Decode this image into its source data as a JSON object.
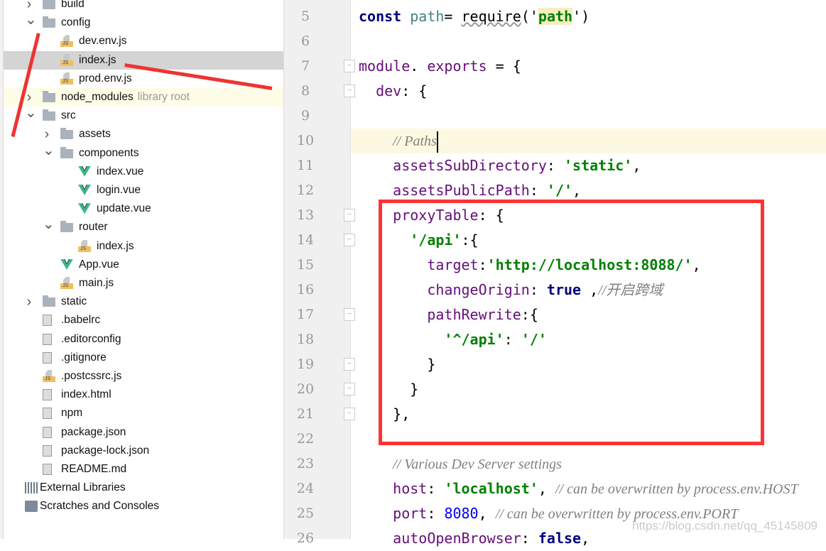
{
  "project_tree": [
    {
      "label": "build",
      "icon": "folder-icon",
      "depth": 0,
      "chevron": "right"
    },
    {
      "label": "config",
      "icon": "folder-icon",
      "depth": 0,
      "chevron": "down"
    },
    {
      "label": "dev.env.js",
      "icon": "js-file-icon",
      "depth": 1
    },
    {
      "label": "index.js",
      "icon": "js-file-icon",
      "depth": 1,
      "selected": true
    },
    {
      "label": "prod.env.js",
      "icon": "js-file-icon",
      "depth": 1
    },
    {
      "label": "node_modules",
      "hint": "library root",
      "icon": "folder-icon",
      "depth": 0,
      "chevron": "right",
      "library": true
    },
    {
      "label": "src",
      "icon": "folder-icon",
      "depth": 0,
      "chevron": "down"
    },
    {
      "label": "assets",
      "icon": "folder-icon",
      "depth": 1,
      "chevron": "right"
    },
    {
      "label": "components",
      "icon": "folder-icon",
      "depth": 1,
      "chevron": "down"
    },
    {
      "label": "index.vue",
      "icon": "vue-file-icon",
      "depth": 2
    },
    {
      "label": "login.vue",
      "icon": "vue-file-icon",
      "depth": 2
    },
    {
      "label": "update.vue",
      "icon": "vue-file-icon",
      "depth": 2
    },
    {
      "label": "router",
      "icon": "folder-icon",
      "depth": 1,
      "chevron": "down"
    },
    {
      "label": "index.js",
      "icon": "js-file-icon",
      "depth": 2
    },
    {
      "label": "App.vue",
      "icon": "vue-file-icon",
      "depth": 1
    },
    {
      "label": "main.js",
      "icon": "js-file-icon",
      "depth": 1
    },
    {
      "label": "static",
      "icon": "folder-icon",
      "depth": 0,
      "chevron": "right"
    },
    {
      "label": ".babelrc",
      "icon": "config-file-icon",
      "depth": 0
    },
    {
      "label": ".editorconfig",
      "icon": "text-file-icon",
      "depth": 0
    },
    {
      "label": ".gitignore",
      "icon": "text-file-icon",
      "depth": 0
    },
    {
      "label": ".postcssrc.js",
      "icon": "js-file-icon",
      "depth": 0
    },
    {
      "label": "index.html",
      "icon": "html-file-icon",
      "depth": 0
    },
    {
      "label": "npm",
      "icon": "unknown-file-icon",
      "depth": 0
    },
    {
      "label": "package.json",
      "icon": "json-file-icon",
      "depth": 0
    },
    {
      "label": "package-lock.json",
      "icon": "json-file-icon",
      "depth": 0
    },
    {
      "label": "README.md",
      "icon": "text-file-icon",
      "depth": 0
    },
    {
      "label": "External Libraries",
      "icon": "library-icon",
      "depth": -1
    },
    {
      "label": "Scratches and Consoles",
      "icon": "scratches-icon",
      "depth": -1
    }
  ],
  "editor": {
    "current_line": 10,
    "lines": [
      {
        "n": "5",
        "t": [
          [
            "k",
            "const "
          ],
          [
            "v",
            "path"
          ],
          [
            "",
            "= "
          ],
          [
            "w",
            "require"
          ],
          [
            "",
            "('"
          ],
          [
            "s hl",
            "path"
          ],
          [
            "",
            "')"
          ]
        ]
      },
      {
        "n": "6",
        "t": []
      },
      {
        "n": "7",
        "t": [
          [
            "p",
            "module"
          ],
          [
            "",
            ". "
          ],
          [
            "p",
            "exports"
          ],
          [
            "",
            " = {"
          ]
        ]
      },
      {
        "n": "8",
        "t": [
          [
            "",
            "  "
          ],
          [
            "p",
            "dev"
          ],
          [
            "",
            ": {"
          ]
        ]
      },
      {
        "n": "9",
        "t": []
      },
      {
        "n": "10",
        "t": [
          [
            "",
            "    "
          ],
          [
            "c",
            "// Paths"
          ]
        ]
      },
      {
        "n": "11",
        "t": [
          [
            "",
            "    "
          ],
          [
            "p",
            "assetsSubDirectory"
          ],
          [
            "",
            ": "
          ],
          [
            "s",
            "'static'"
          ],
          [
            "",
            ","
          ]
        ]
      },
      {
        "n": "12",
        "t": [
          [
            "",
            "    "
          ],
          [
            "p",
            "assetsPublicPath"
          ],
          [
            "",
            ": "
          ],
          [
            "s",
            "'/'"
          ],
          [
            "",
            ","
          ]
        ]
      },
      {
        "n": "13",
        "t": [
          [
            "",
            "    "
          ],
          [
            "p",
            "proxyTable"
          ],
          [
            "",
            ": {"
          ]
        ]
      },
      {
        "n": "14",
        "t": [
          [
            "",
            "      "
          ],
          [
            "s",
            "'/api'"
          ],
          [
            "",
            ":{"
          ]
        ]
      },
      {
        "n": "15",
        "t": [
          [
            "",
            "        "
          ],
          [
            "p",
            "target"
          ],
          [
            "",
            ":"
          ],
          [
            "s",
            "'http://localhost:8088/'"
          ],
          [
            "",
            ","
          ]
        ]
      },
      {
        "n": "16",
        "t": [
          [
            "",
            "        "
          ],
          [
            "p",
            "changeOrigin"
          ],
          [
            "",
            ": "
          ],
          [
            "k",
            "true"
          ],
          [
            "",
            " ,"
          ],
          [
            "c",
            "//开启跨域"
          ]
        ]
      },
      {
        "n": "17",
        "t": [
          [
            "",
            "        "
          ],
          [
            "p",
            "pathRewrite"
          ],
          [
            "",
            ":{"
          ]
        ]
      },
      {
        "n": "18",
        "t": [
          [
            "",
            "          "
          ],
          [
            "s",
            "'^/api'"
          ],
          [
            "",
            ": "
          ],
          [
            "s",
            "'/'"
          ]
        ]
      },
      {
        "n": "19",
        "t": [
          [
            "",
            "        }"
          ]
        ]
      },
      {
        "n": "20",
        "t": [
          [
            "",
            "      }"
          ]
        ]
      },
      {
        "n": "21",
        "t": [
          [
            "",
            "    },"
          ]
        ]
      },
      {
        "n": "22",
        "t": []
      },
      {
        "n": "23",
        "t": [
          [
            "",
            "    "
          ],
          [
            "c",
            "// Various Dev Server settings"
          ]
        ]
      },
      {
        "n": "24",
        "t": [
          [
            "",
            "    "
          ],
          [
            "p",
            "host"
          ],
          [
            "",
            ": "
          ],
          [
            "s",
            "'localhost'"
          ],
          [
            "",
            ", "
          ],
          [
            "c",
            "// can be overwritten by process.env.HOST"
          ]
        ]
      },
      {
        "n": "25",
        "t": [
          [
            "",
            "    "
          ],
          [
            "p",
            "port"
          ],
          [
            "",
            ": "
          ],
          [
            "n",
            "8080"
          ],
          [
            "",
            ", "
          ],
          [
            "c",
            "// can be overwritten by process.env.PORT"
          ]
        ]
      },
      {
        "n": "26",
        "t": [
          [
            "",
            "    "
          ],
          [
            "p",
            "autoOpenBrowser"
          ],
          [
            "",
            ": "
          ],
          [
            "k",
            "false"
          ],
          [
            "",
            ","
          ]
        ]
      }
    ],
    "fold_lines": [
      7,
      8,
      13,
      14,
      17,
      19,
      20,
      21
    ]
  },
  "annotation_color": "#f33",
  "watermark": "https://blog.csdn.net/qq_45145809"
}
